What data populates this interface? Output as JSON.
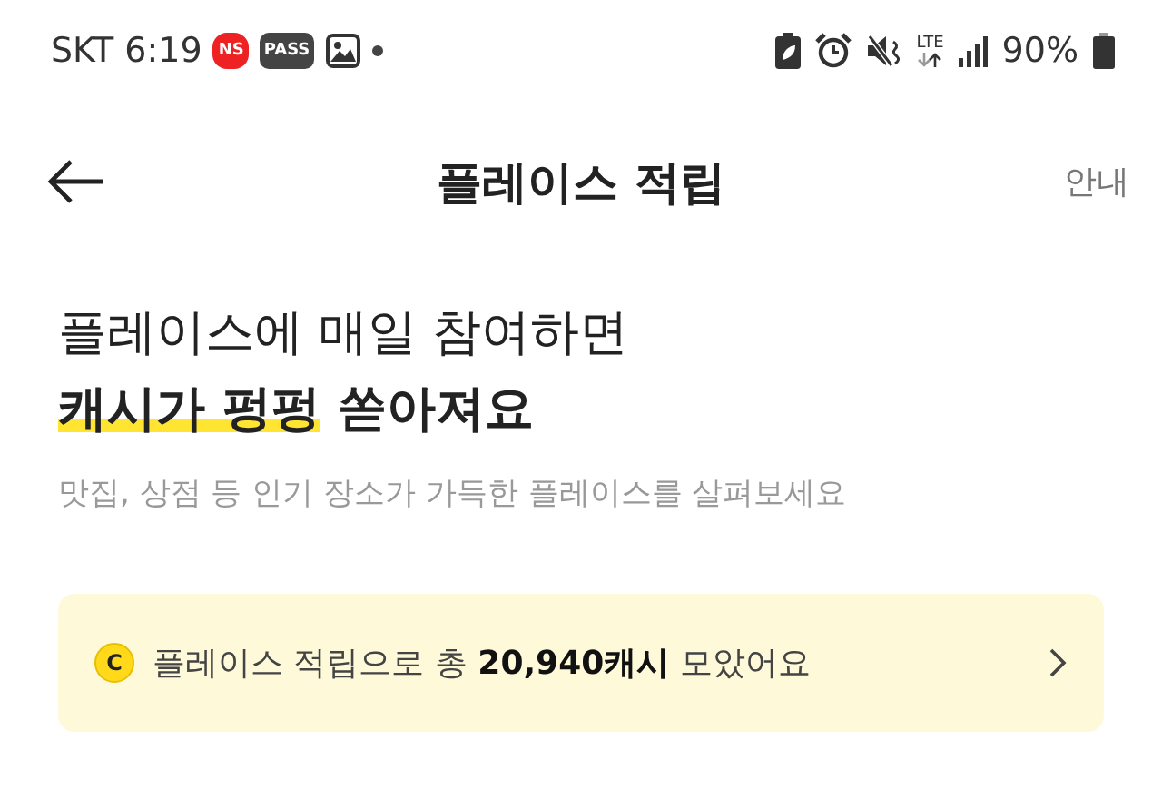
{
  "status_bar": {
    "carrier": "SKT",
    "time": "6:19",
    "badges": [
      "NS",
      "PASS"
    ],
    "network": "LTE",
    "battery": "90%"
  },
  "header": {
    "title": "플레이스 적립",
    "action": "안내"
  },
  "intro": {
    "line1": "플레이스에 매일 참여하면",
    "highlight": "캐시가 펑펑",
    "rest": "쏟아져요",
    "subtitle": "맛집, 상점 등 인기 장소가 가득한 플레이스를 살펴보세요"
  },
  "banner": {
    "coin": "C",
    "text": "플레이스 적립으로 총 **20,940캐시** 모았어요"
  }
}
